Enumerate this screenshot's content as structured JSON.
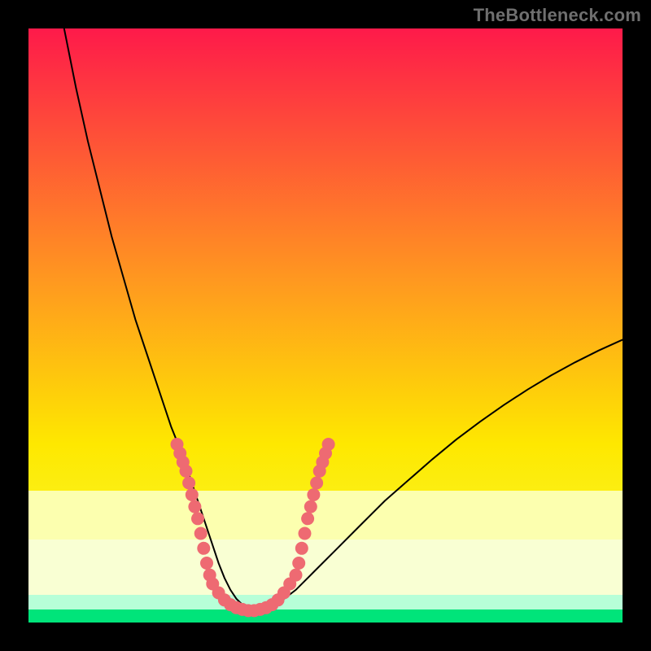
{
  "watermark": "TheBottleneck.com",
  "colors": {
    "frame": "#000000",
    "top": "#fe1a4a",
    "mid": "#fee800",
    "low": "#f4ff42",
    "band_pale": "#fcffaf",
    "band_cream": "#f9ffd3",
    "band_mint": "#b7ffd8",
    "band_green": "#00e47a",
    "curve": "#000000",
    "marker": "#ee6a72"
  },
  "chart_data": {
    "type": "line",
    "title": "",
    "xlabel": "",
    "ylabel": "",
    "xlim": [
      0,
      100
    ],
    "ylim": [
      0,
      100
    ],
    "series": [
      {
        "name": "bottleneck-curve",
        "x": [
          6,
          8,
          10,
          12,
          14,
          16,
          18,
          20,
          22,
          24,
          26,
          27,
          28,
          29,
          30,
          31,
          32,
          33,
          34,
          35,
          36,
          37,
          38,
          39,
          40,
          42,
          45,
          48,
          52,
          56,
          60,
          64,
          68,
          72,
          76,
          80,
          84,
          88,
          92,
          96,
          100
        ],
        "y": [
          100,
          90,
          81,
          73,
          65,
          58,
          51,
          45,
          39,
          33,
          28,
          25,
          22,
          19,
          16,
          13,
          10,
          7.5,
          5.5,
          4,
          3,
          2.3,
          2,
          2,
          2.3,
          3.2,
          5.5,
          8.5,
          12.5,
          16.5,
          20.5,
          24,
          27.5,
          30.8,
          33.8,
          36.6,
          39.2,
          41.6,
          43.8,
          45.8,
          47.6
        ]
      }
    ],
    "markers": [
      {
        "x": 25,
        "y": 30
      },
      {
        "x": 25.5,
        "y": 28.5
      },
      {
        "x": 26,
        "y": 27
      },
      {
        "x": 26.5,
        "y": 25.5
      },
      {
        "x": 27,
        "y": 23.5
      },
      {
        "x": 27.5,
        "y": 21.5
      },
      {
        "x": 28,
        "y": 19.5
      },
      {
        "x": 28.5,
        "y": 17.5
      },
      {
        "x": 29,
        "y": 15
      },
      {
        "x": 29.5,
        "y": 12.5
      },
      {
        "x": 30,
        "y": 10
      },
      {
        "x": 30.5,
        "y": 8
      },
      {
        "x": 31,
        "y": 6.5
      },
      {
        "x": 32,
        "y": 5
      },
      {
        "x": 33,
        "y": 3.8
      },
      {
        "x": 34,
        "y": 3
      },
      {
        "x": 35,
        "y": 2.5
      },
      {
        "x": 36,
        "y": 2.2
      },
      {
        "x": 37,
        "y": 2
      },
      {
        "x": 38,
        "y": 2
      },
      {
        "x": 39,
        "y": 2.2
      },
      {
        "x": 40,
        "y": 2.5
      },
      {
        "x": 41,
        "y": 3
      },
      {
        "x": 42,
        "y": 3.8
      },
      {
        "x": 43,
        "y": 5
      },
      {
        "x": 44,
        "y": 6.5
      },
      {
        "x": 45,
        "y": 8
      },
      {
        "x": 45.5,
        "y": 10
      },
      {
        "x": 46,
        "y": 12.5
      },
      {
        "x": 46.5,
        "y": 15
      },
      {
        "x": 47,
        "y": 17.5
      },
      {
        "x": 47.5,
        "y": 19.5
      },
      {
        "x": 48,
        "y": 21.5
      },
      {
        "x": 48.5,
        "y": 23.5
      },
      {
        "x": 49,
        "y": 25.5
      },
      {
        "x": 49.5,
        "y": 27
      },
      {
        "x": 50,
        "y": 28.5
      },
      {
        "x": 50.5,
        "y": 30
      }
    ]
  }
}
